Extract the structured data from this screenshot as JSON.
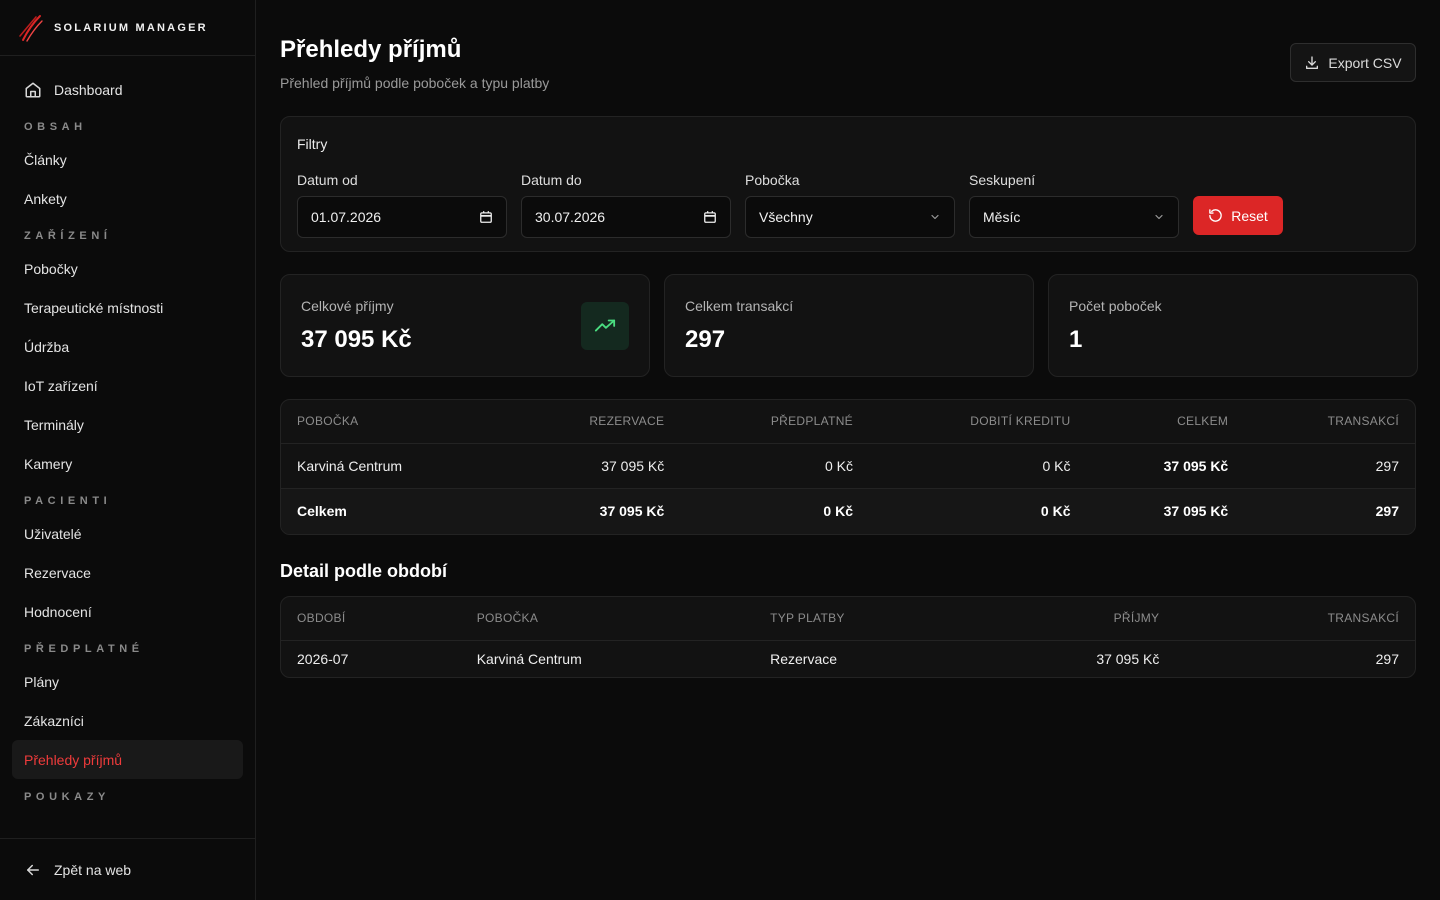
{
  "brand": {
    "name": "SOLARIUM MANAGER",
    "accent": "#dc2626"
  },
  "sidebar": {
    "dashboard": "Dashboard",
    "sections": [
      {
        "title": "OBSAH",
        "items": [
          "Články",
          "Ankety"
        ]
      },
      {
        "title": "ZAŘÍZENÍ",
        "items": [
          "Pobočky",
          "Terapeutické místnosti",
          "Údržba",
          "IoT zařízení",
          "Terminály",
          "Kamery"
        ]
      },
      {
        "title": "PACIENTI",
        "items": [
          "Uživatelé",
          "Rezervace",
          "Hodnocení"
        ]
      },
      {
        "title": "PŘEDPLATNÉ",
        "items": [
          "Plány",
          "Zákazníci",
          "Přehledy příjmů"
        ]
      },
      {
        "title": "POUKAZY",
        "items": []
      }
    ],
    "active_item": "Přehledy příjmů",
    "footer": "Zpět na web"
  },
  "header": {
    "title": "Přehledy příjmů",
    "subtitle": "Přehled příjmů podle poboček a typu platby",
    "export_label": "Export CSV"
  },
  "filters": {
    "title": "Filtry",
    "date_from": {
      "label": "Datum od",
      "value": "01.07.2026"
    },
    "date_to": {
      "label": "Datum do",
      "value": "30.07.2026"
    },
    "branch": {
      "label": "Pobočka",
      "value": "Všechny"
    },
    "grouping": {
      "label": "Seskupení",
      "value": "Měsíc"
    },
    "reset_label": "Reset"
  },
  "stats": [
    {
      "label": "Celkové příjmy",
      "value": "37 095 Kč",
      "icon": "trending-up-icon"
    },
    {
      "label": "Celkem transakcí",
      "value": "297"
    },
    {
      "label": "Počet poboček",
      "value": "1"
    }
  ],
  "summary_table": {
    "columns": [
      "POBOČKA",
      "REZERVACE",
      "PŘEDPLATNÉ",
      "DOBITÍ KREDITU",
      "CELKEM",
      "TRANSAKCÍ"
    ],
    "rows": [
      [
        "Karviná Centrum",
        "37 095 Kč",
        "0 Kč",
        "0 Kč",
        "37 095 Kč",
        "297"
      ]
    ],
    "total": [
      "Celkem",
      "37 095 Kč",
      "0 Kč",
      "0 Kč",
      "37 095 Kč",
      "297"
    ]
  },
  "detail": {
    "title": "Detail podle období",
    "columns": [
      "OBDOBÍ",
      "POBOČKA",
      "TYP PLATBY",
      "PŘÍJMY",
      "TRANSAKCÍ"
    ],
    "rows": [
      [
        "2026-07",
        "Karviná Centrum",
        "Rezervace",
        "37 095 Kč",
        "297"
      ]
    ]
  }
}
